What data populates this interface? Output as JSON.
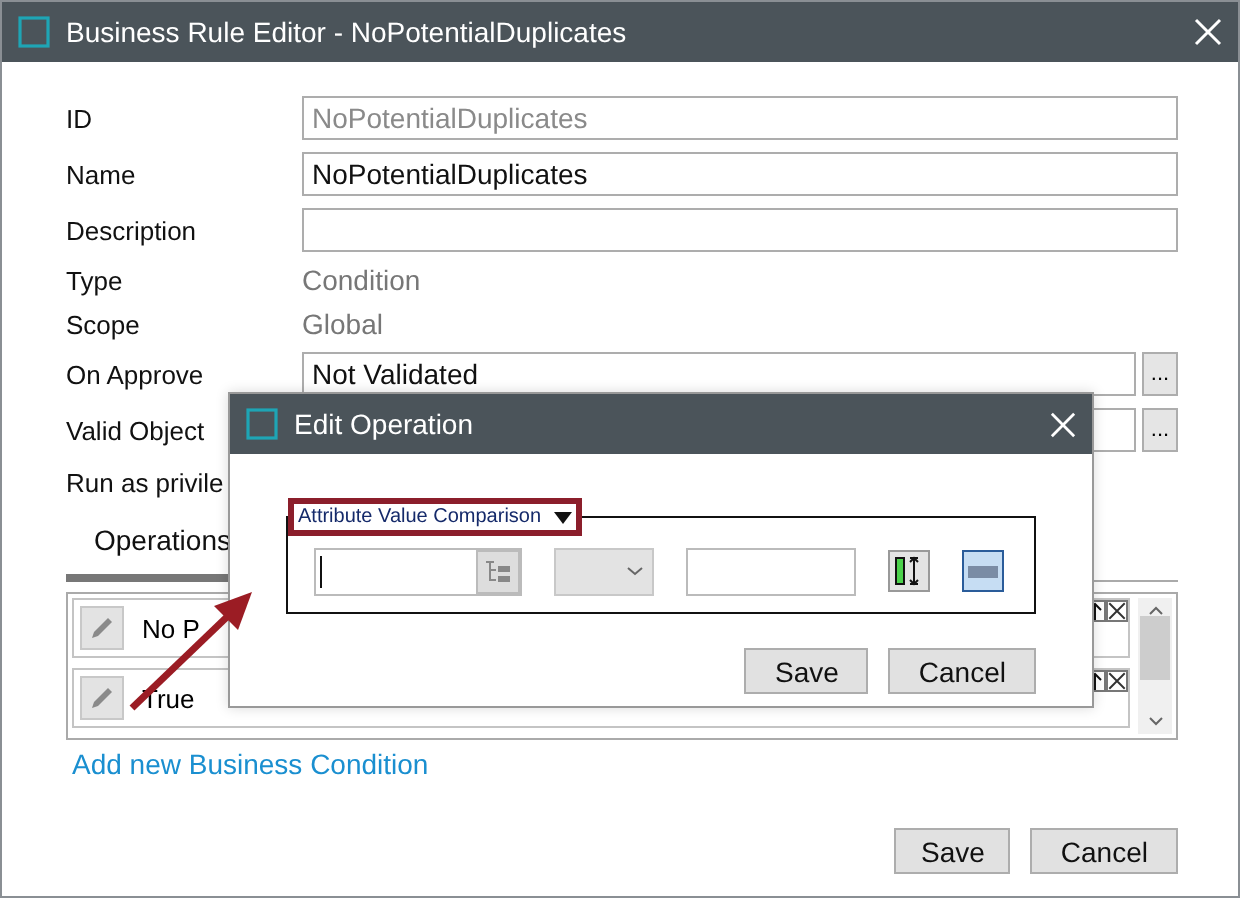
{
  "window": {
    "title": "Business Rule Editor - NoPotentialDuplicates"
  },
  "form": [
    {
      "kind": "field",
      "label": "ID",
      "value": "NoPotentialDuplicates",
      "disabled": true
    },
    {
      "kind": "field",
      "label": "Name",
      "value": "NoPotentialDuplicates",
      "disabled": false
    },
    {
      "kind": "field",
      "label": "Description"
    },
    {
      "kind": "readonly",
      "label": "Type",
      "value": "Condition"
    },
    {
      "kind": "readonly",
      "label": "Scope",
      "value": "Global"
    },
    {
      "kind": "field_more",
      "label": "On Approve",
      "value": "Not Validated",
      "button": "..."
    },
    {
      "kind": "field_more",
      "label": "Valid Object",
      "button": "..."
    },
    {
      "kind": "label",
      "label": "Run as privile"
    }
  ],
  "tabs": [
    {
      "label": "Operations",
      "selected": true
    }
  ],
  "operations": [
    {
      "text": "No P"
    },
    {
      "text": "True"
    }
  ],
  "add_link": "Add new Business Condition",
  "buttons": [
    "Save",
    "Cancel"
  ],
  "dialog": {
    "title": "Edit Operation",
    "comparison_type": "Attribute Value Comparison",
    "buttons": [
      "Save",
      "Cancel"
    ],
    "highlighted": true
  }
}
